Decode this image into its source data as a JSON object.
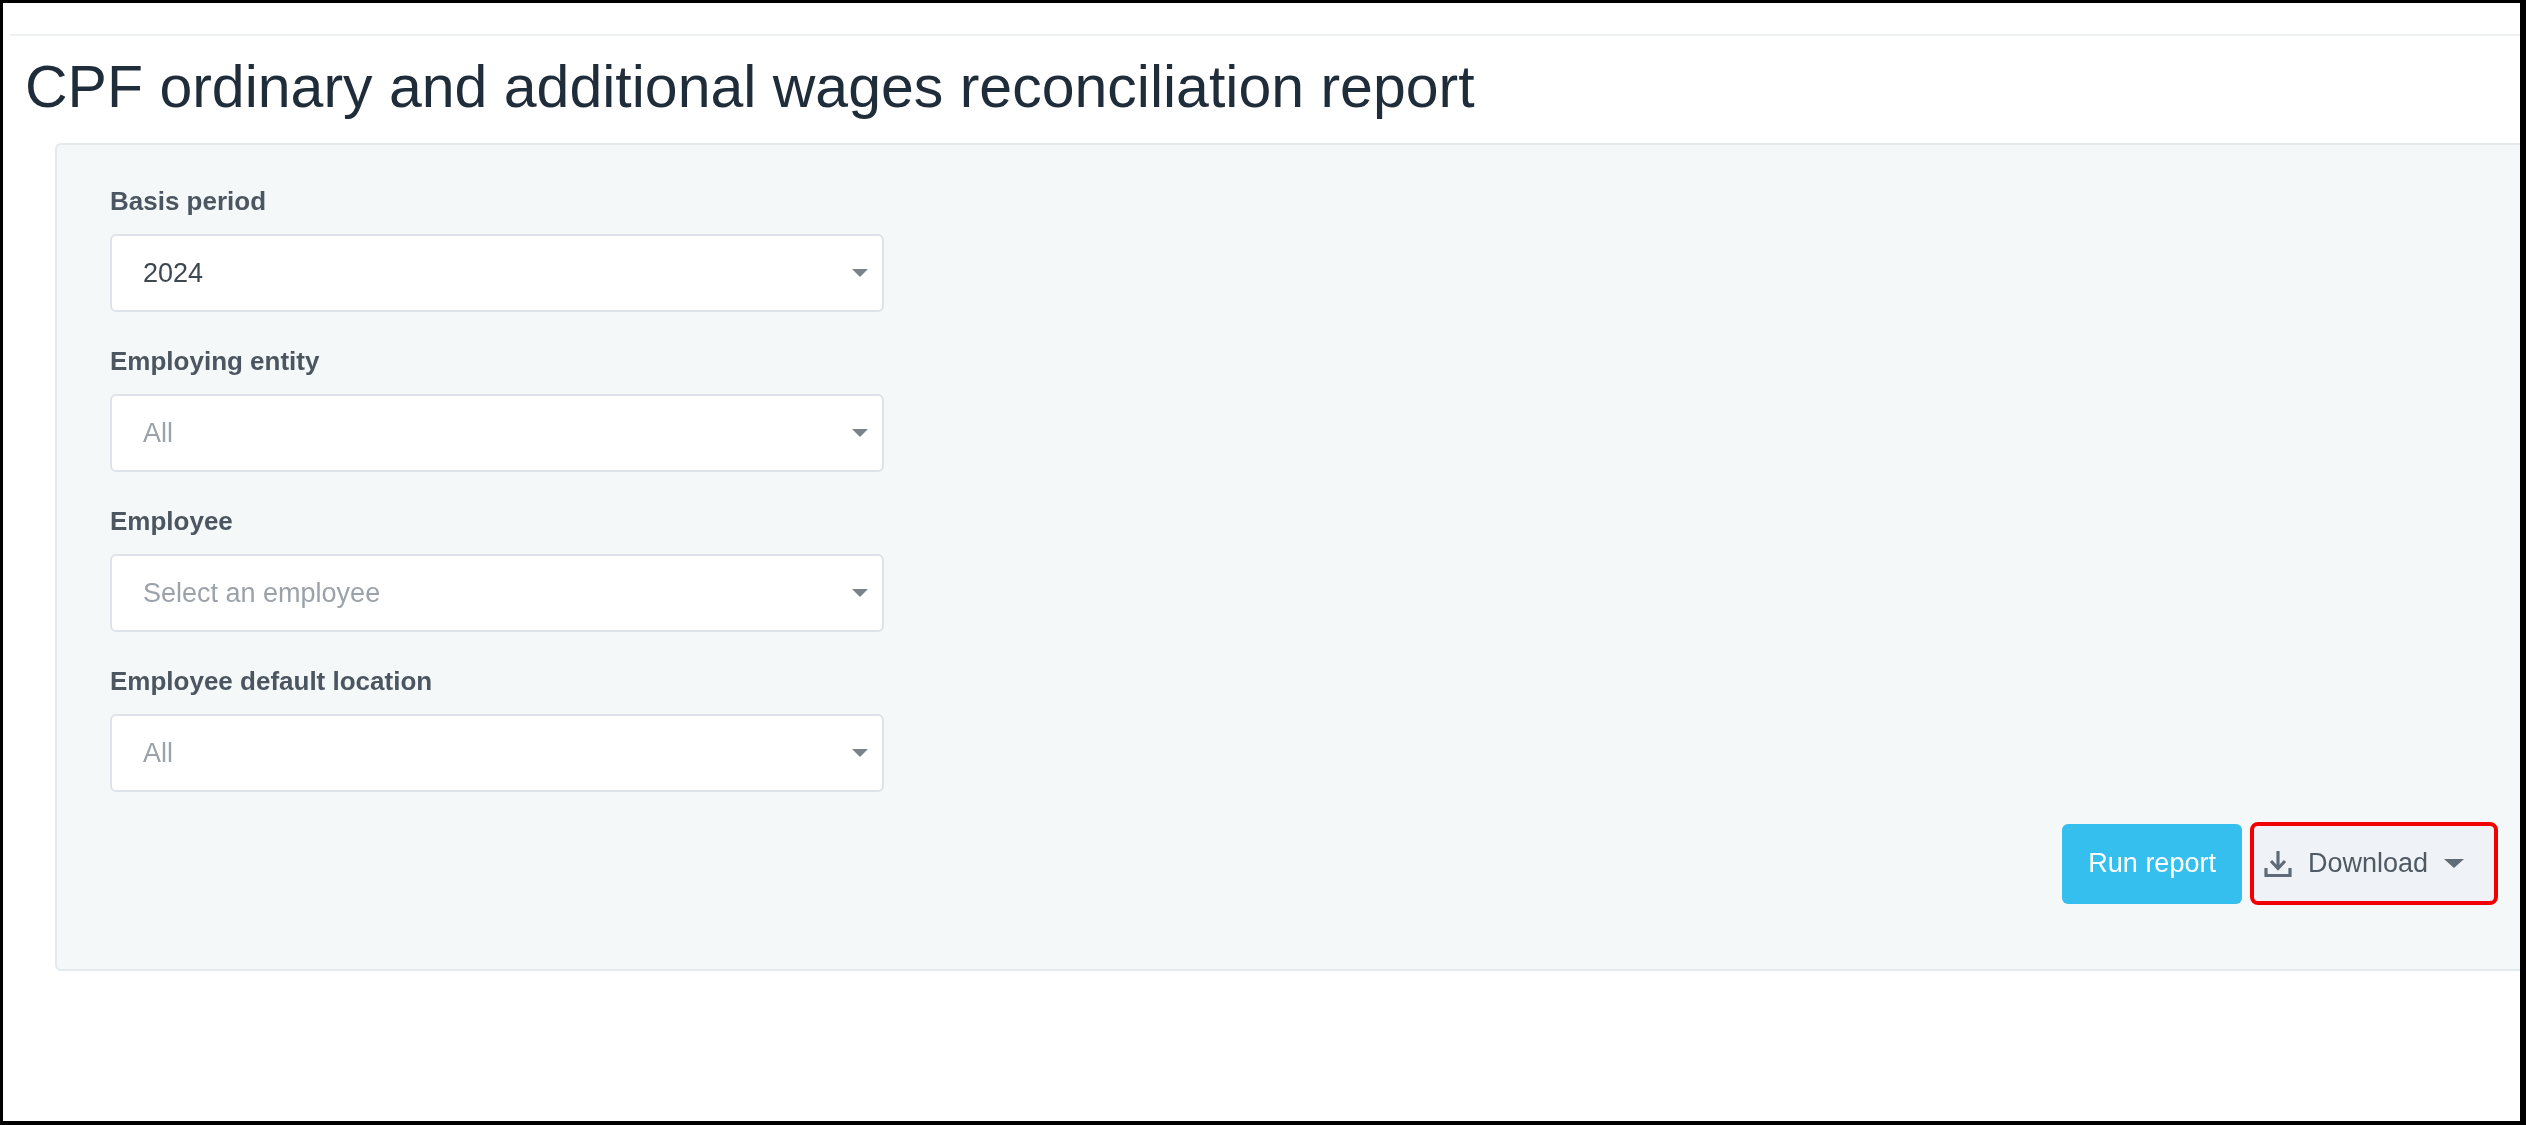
{
  "page": {
    "title": "CPF ordinary and additional wages reconciliation report"
  },
  "filters": [
    {
      "label": "Basis period",
      "value": "2024"
    },
    {
      "label": "Employing entity",
      "placeholder": "All"
    },
    {
      "label": "Employee",
      "placeholder": "Select an employee"
    },
    {
      "label": "Employee default location",
      "placeholder": "All"
    }
  ],
  "actions": [
    {
      "kind": "primary",
      "label": "Run report",
      "highlighted": false
    },
    {
      "kind": "dropdown",
      "label": "Download",
      "highlighted": true
    }
  ]
}
